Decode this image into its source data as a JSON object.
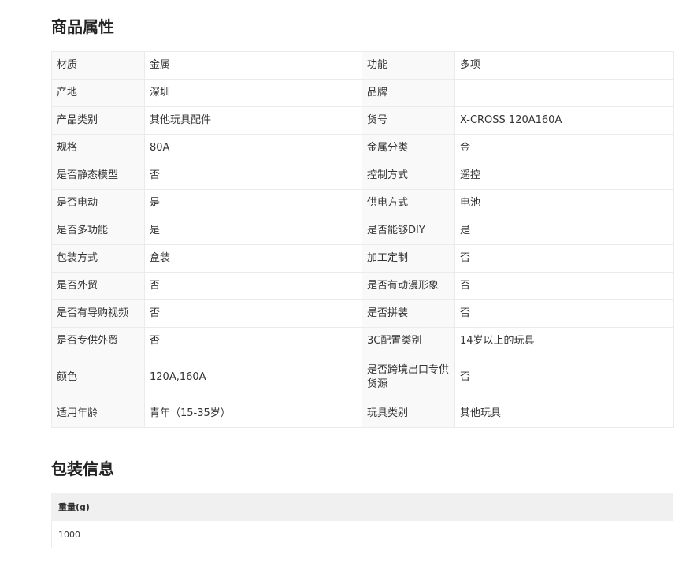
{
  "section1_title": "商品属性",
  "attributes": [
    [
      "材质",
      "金属",
      "功能",
      "多项"
    ],
    [
      "产地",
      "深圳",
      "品牌",
      ""
    ],
    [
      "产品类别",
      "其他玩具配件",
      "货号",
      "X-CROSS 120A160A"
    ],
    [
      "规格",
      "80A",
      "金属分类",
      "金"
    ],
    [
      "是否静态模型",
      "否",
      "控制方式",
      "遥控"
    ],
    [
      "是否电动",
      "是",
      "供电方式",
      "电池"
    ],
    [
      "是否多功能",
      "是",
      "是否能够DIY",
      "是"
    ],
    [
      "包装方式",
      "盒装",
      "加工定制",
      "否"
    ],
    [
      "是否外贸",
      "否",
      "是否有动漫形象",
      "否"
    ],
    [
      "是否有导购视频",
      "否",
      "是否拼装",
      "否"
    ],
    [
      "是否专供外贸",
      "否",
      "3C配置类别",
      "14岁以上的玩具"
    ],
    [
      "颜色",
      "120A,160A",
      "是否跨境出口专供货源",
      "否"
    ],
    [
      "适用年龄",
      "青年（15-35岁）",
      "玩具类别",
      "其他玩具"
    ]
  ],
  "section2_title": "包装信息",
  "package": {
    "header": "重量(g)",
    "value": "1000"
  }
}
